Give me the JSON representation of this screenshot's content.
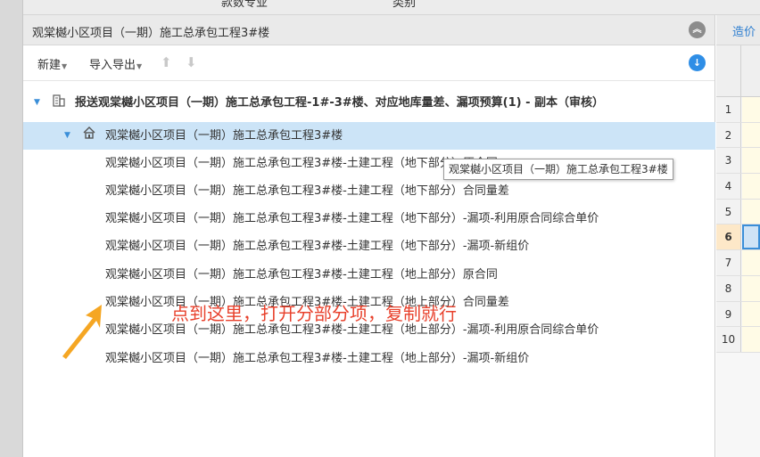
{
  "topbar": {
    "tab1": "款数专业",
    "tab2": "类别"
  },
  "panel": {
    "title": "观棠樾小区项目（一期）施工总承包工程3#楼",
    "collapse_icon": "chevron-double-up-icon"
  },
  "toolbar": {
    "new_label": "新建",
    "import_export_label": "导入导出",
    "download_icon": "download-icon"
  },
  "tree": {
    "root": "报送观棠樾小区项目（一期）施工总承包工程-1#-3#楼、对应地库量差、漏项预算(1) - 副本（审核）",
    "building": "观棠樾小区项目（一期）施工总承包工程3#楼",
    "items": [
      "观棠樾小区项目（一期）施工总承包工程3#楼-土建工程（地下部分）原合同",
      "观棠樾小区项目（一期）施工总承包工程3#楼-土建工程（地下部分）合同量差",
      "观棠樾小区项目（一期）施工总承包工程3#楼-土建工程（地下部分）-漏项-利用原合同综合单价",
      "观棠樾小区项目（一期）施工总承包工程3#楼-土建工程（地下部分）-漏项-新组价",
      "观棠樾小区项目（一期）施工总承包工程3#楼-土建工程（地上部分）原合同",
      "观棠樾小区项目（一期）施工总承包工程3#楼-土建工程（地上部分）合同量差",
      "观棠樾小区项目（一期）施工总承包工程3#楼-土建工程（地上部分）-漏项-利用原合同综合单价",
      "观棠樾小区项目（一期）施工总承包工程3#楼-土建工程（地上部分）-漏项-新组价"
    ]
  },
  "tooltip": "观棠樾小区项目（一期）施工总承包工程3#楼",
  "annotation": "点到这里，打开分部分项，复制就行",
  "right_panel": {
    "tab": "造价",
    "rows": [
      "1",
      "2",
      "3",
      "4",
      "5",
      "6",
      "7",
      "8",
      "9",
      "10"
    ],
    "active_row": "6"
  },
  "colors": {
    "accent": "#3a8ed8",
    "selection": "#cce4f7",
    "annotation": "#e8412c",
    "arrow": "#f5a623"
  }
}
